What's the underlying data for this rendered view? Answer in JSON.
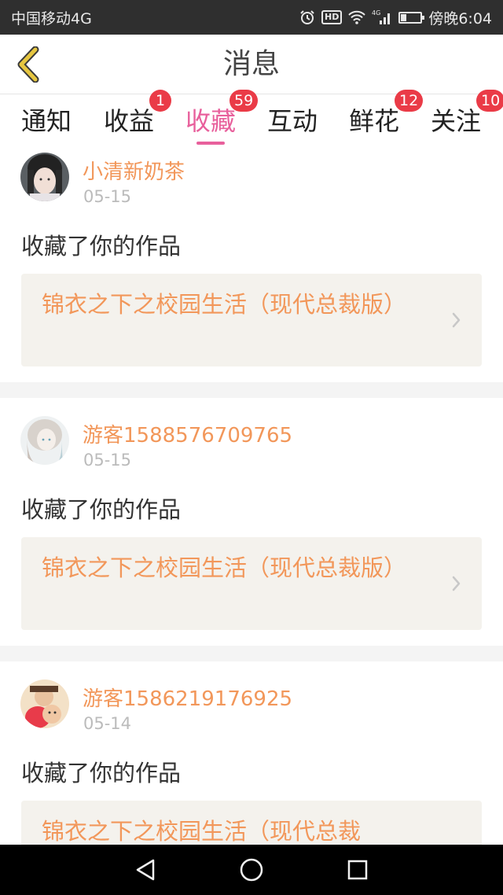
{
  "status_bar": {
    "carrier": "中国移动4G",
    "network": "4G",
    "time": "傍晚6:04"
  },
  "header": {
    "title": "消息"
  },
  "tabs": [
    {
      "label": "通知",
      "badge": ""
    },
    {
      "label": "收益",
      "badge": "1"
    },
    {
      "label": "收藏",
      "badge": "59",
      "active": true
    },
    {
      "label": "互动",
      "badge": ""
    },
    {
      "label": "鲜花",
      "badge": "12"
    },
    {
      "label": "关注",
      "badge": "10"
    }
  ],
  "messages": [
    {
      "username": "小清新奶茶",
      "date": "05-15",
      "action": "收藏了你的作品",
      "work_title": "锦衣之下之校园生活（现代总裁版）"
    },
    {
      "username": "游客1588576709765",
      "date": "05-15",
      "action": "收藏了你的作品",
      "work_title": "锦衣之下之校园生活（现代总裁版）"
    },
    {
      "username": "游客1586219176925",
      "date": "05-14",
      "action": "收藏了你的作品",
      "work_title": "锦衣之下之校园生活（现代总裁"
    }
  ],
  "colors": {
    "accent": "#e8609c",
    "username": "#f2975a",
    "badge": "#ea3b47",
    "back_arrow": "#c9a227"
  },
  "icons": {
    "back": "chevron-left-icon",
    "alarm": "alarm-icon",
    "wifi": "wifi-icon",
    "signal": "signal-icon",
    "battery": "battery-icon",
    "nav_back": "triangle-back-icon",
    "nav_home": "circle-home-icon",
    "nav_recent": "square-recent-icon"
  }
}
